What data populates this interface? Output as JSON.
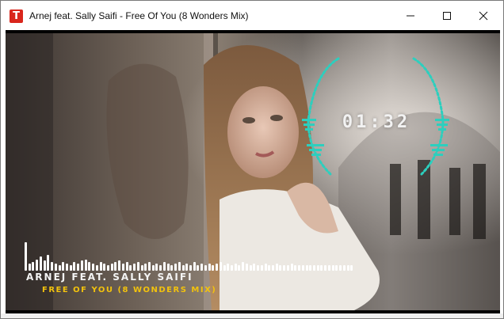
{
  "window": {
    "app_icon_letter": "T",
    "title": "Arnej feat. Sally Saifi - Free Of You (8 Wonders Mix)"
  },
  "player": {
    "time": "01:32",
    "artist": "ARNEJ FEAT. SALLY SAIFI",
    "track": "FREE OF YOU (8 WONDERS MIX)",
    "accent_color": "#2ccfbe",
    "track_color": "#f2c20d",
    "spectrum_levels": [
      1.0,
      0.25,
      0.3,
      0.4,
      0.5,
      0.35,
      0.55,
      0.3,
      0.25,
      0.2,
      0.3,
      0.25,
      0.2,
      0.3,
      0.25,
      0.35,
      0.4,
      0.3,
      0.25,
      0.2,
      0.3,
      0.25,
      0.2,
      0.25,
      0.3,
      0.35,
      0.25,
      0.3,
      0.2,
      0.25,
      0.3,
      0.2,
      0.25,
      0.3,
      0.2,
      0.25,
      0.2,
      0.3,
      0.25,
      0.2,
      0.25,
      0.3,
      0.2,
      0.25,
      0.2,
      0.3,
      0.2,
      0.25,
      0.2,
      0.25,
      0.2,
      0.25,
      0.3,
      0.2,
      0.25,
      0.2,
      0.25,
      0.2,
      0.3,
      0.25,
      0.2,
      0.25,
      0.2,
      0.2,
      0.25,
      0.2,
      0.2,
      0.25,
      0.2,
      0.2,
      0.2,
      0.25,
      0.2,
      0.2,
      0.2,
      0.2,
      0.2,
      0.2,
      0.2,
      0.2,
      0.2,
      0.2,
      0.2,
      0.2,
      0.2,
      0.2,
      0.2,
      0.2
    ]
  }
}
